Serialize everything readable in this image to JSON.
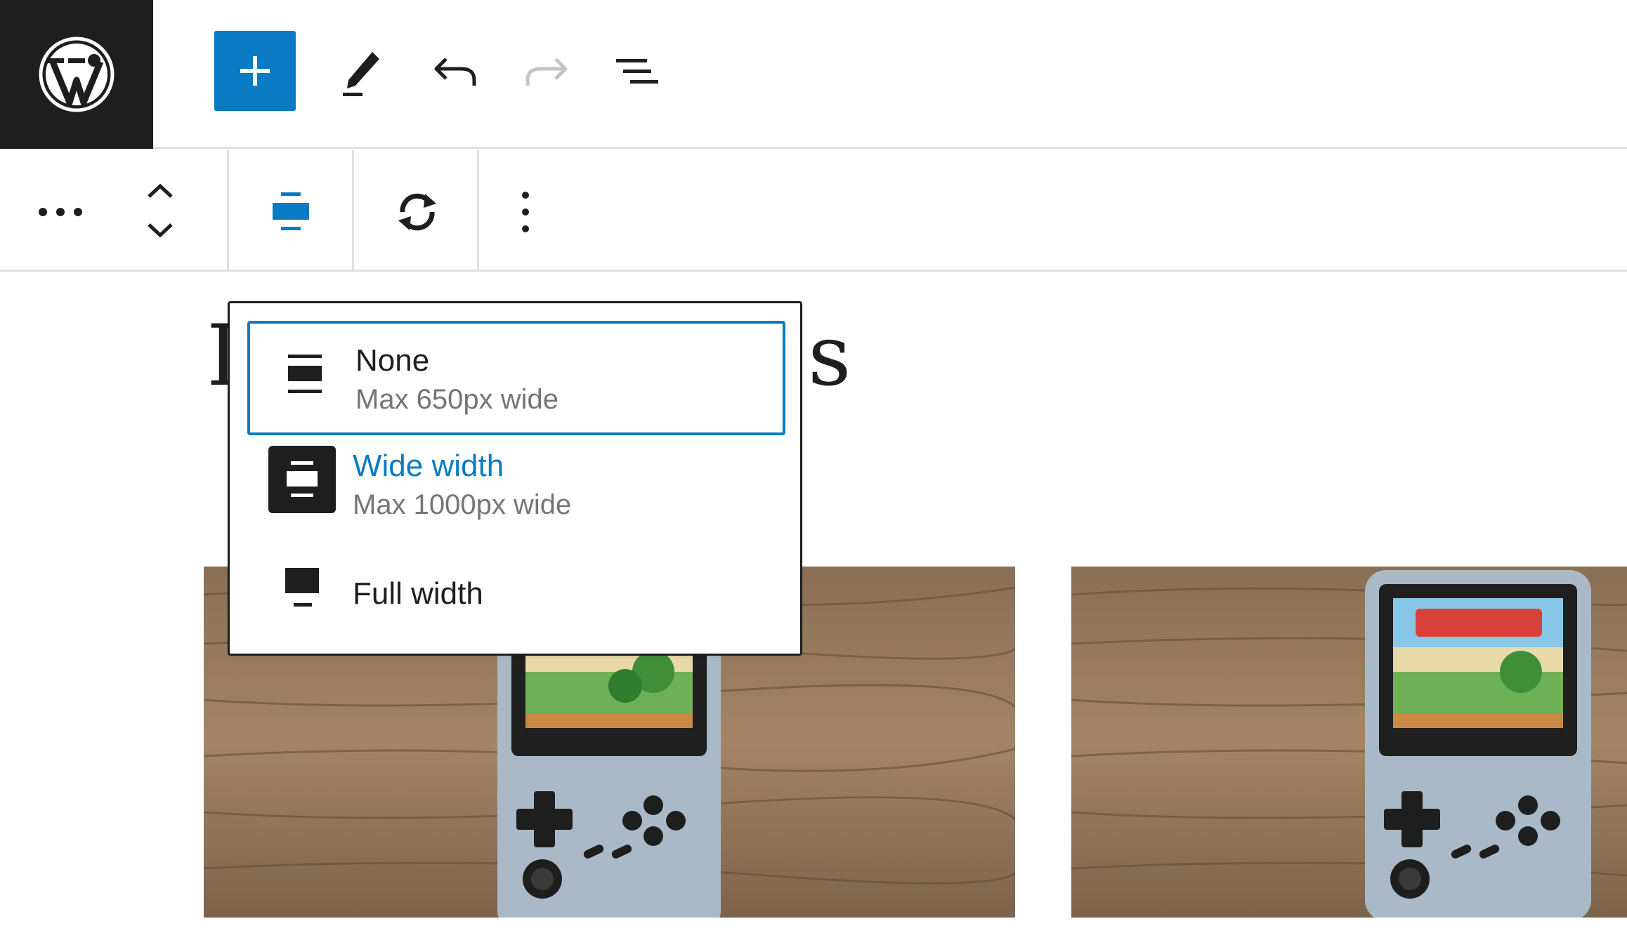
{
  "header": {
    "logo_icon": "wordpress-logo",
    "toggle_inserter_icon": "plus-icon",
    "tools_icon": "pencil-icon",
    "undo_icon": "undo-icon",
    "redo_icon": "redo-icon",
    "list_view_icon": "list-view-icon"
  },
  "block_toolbar": {
    "parent_icon": "ellipsis-horizontal-icon",
    "move_icons": [
      "chevron-up-icon",
      "chevron-down-icon"
    ],
    "align_icon": "align-none-icon",
    "transform_icon": "rotate-arrows-icon",
    "options_icon": "vertical-ellipsis-icon"
  },
  "content": {
    "title_start": "I",
    "title_end": "s"
  },
  "alignment_menu": {
    "options": [
      {
        "label": "None",
        "description": "Max 650px wide",
        "icon": "align-none-icon",
        "state": "focused"
      },
      {
        "label": "Wide width",
        "description": "Max 1000px wide",
        "icon": "align-wide-icon",
        "state": "selected"
      },
      {
        "label": "Full width",
        "description": "",
        "icon": "align-full-icon",
        "state": "default"
      }
    ]
  },
  "colors": {
    "accent": "#0a7bc2",
    "dark": "#1e1e1e",
    "muted": "#757575",
    "border": "#e0e0e0"
  }
}
